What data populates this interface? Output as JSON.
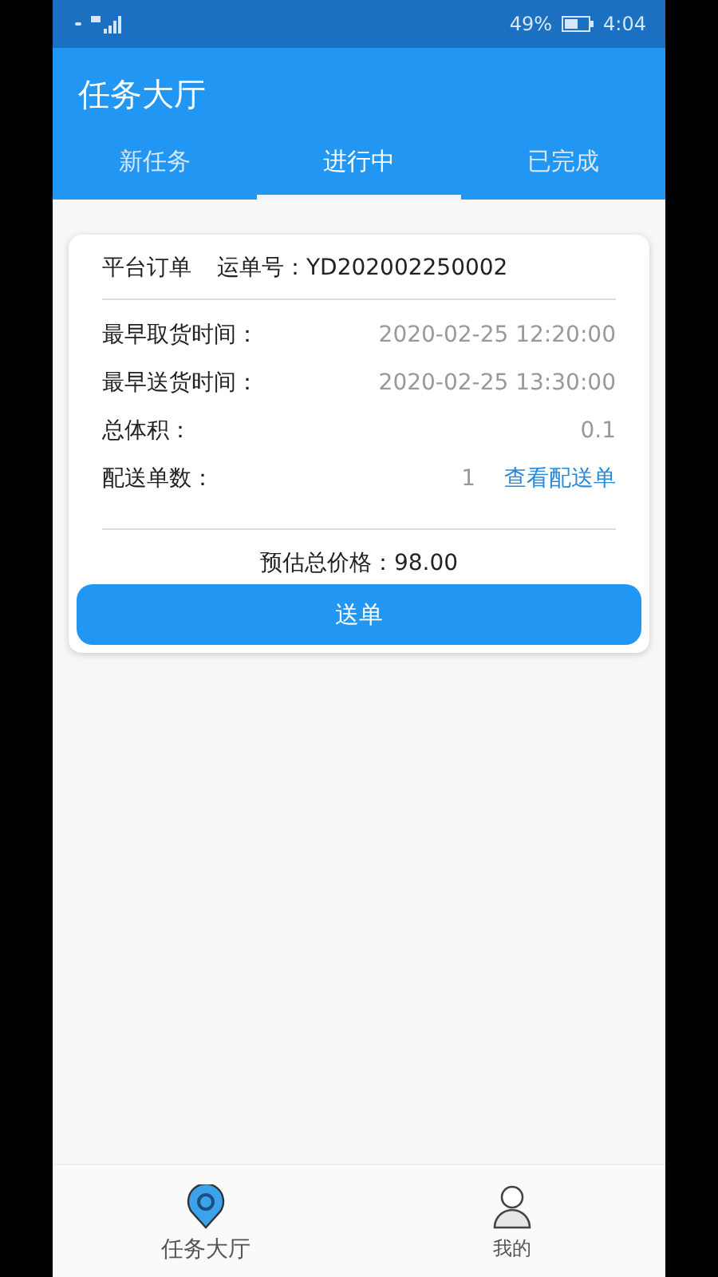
{
  "status_bar": {
    "battery_percent": "49%",
    "time": "4:04"
  },
  "header": {
    "title": "任务大厅"
  },
  "tabs": [
    {
      "label": "新任务",
      "selected": false
    },
    {
      "label": "进行中",
      "selected": true
    },
    {
      "label": "已完成",
      "selected": false
    }
  ],
  "order_card": {
    "source": "平台订单",
    "waybill_label": "运单号：",
    "waybill_number": "YD202002250002",
    "fields": [
      {
        "label": "最早取货时间：",
        "value": "2020-02-25 12:20:00"
      },
      {
        "label": "最早送货时间：",
        "value": "2020-02-25 13:30:00"
      },
      {
        "label": "总体积：",
        "value": "0.1"
      },
      {
        "label": "配送单数：",
        "value": "1",
        "link": "查看配送单"
      }
    ],
    "price": "预估总价格：98.00",
    "action_button": "送单"
  },
  "bottom_nav": [
    {
      "label": "任务大厅",
      "kind": "pin",
      "selected": true
    },
    {
      "label": "我的",
      "kind": "person",
      "selected": false
    }
  ]
}
